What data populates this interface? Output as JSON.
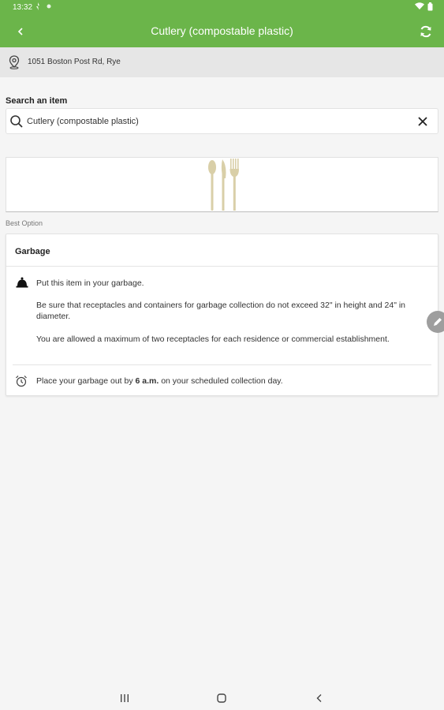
{
  "status_bar": {
    "time": "13:32"
  },
  "app_bar": {
    "title": "Cutlery (compostable plastic)"
  },
  "location": {
    "address": "1051 Boston Post Rd, Rye"
  },
  "search": {
    "label": "Search an item",
    "value": "Cutlery (compostable plastic)"
  },
  "best_option": {
    "label": "Best Option",
    "card": {
      "title": "Garbage",
      "line1": "Put this item in your garbage.",
      "line2": "Be sure that receptacles and containers for garbage collection do not exceed 32\" in height and 24\" in diameter.",
      "line3": "You are allowed a maximum of two receptacles for each residence or commercial establishment.",
      "line4_prefix": "Place your garbage out by ",
      "line4_bold": "6 a.m.",
      "line4_suffix": " on your scheduled collection day."
    }
  },
  "colors": {
    "accent": "#6bb54a",
    "utensil": "#d9cfa8"
  },
  "icons": [
    "back-icon",
    "refresh-icon",
    "location-pin-icon",
    "search-icon",
    "close-icon",
    "cutlery-icon",
    "garbage-bell-icon",
    "alarm-clock-icon",
    "edit-pencil-icon",
    "nav-recents-icon",
    "nav-home-icon",
    "nav-back-icon"
  ]
}
